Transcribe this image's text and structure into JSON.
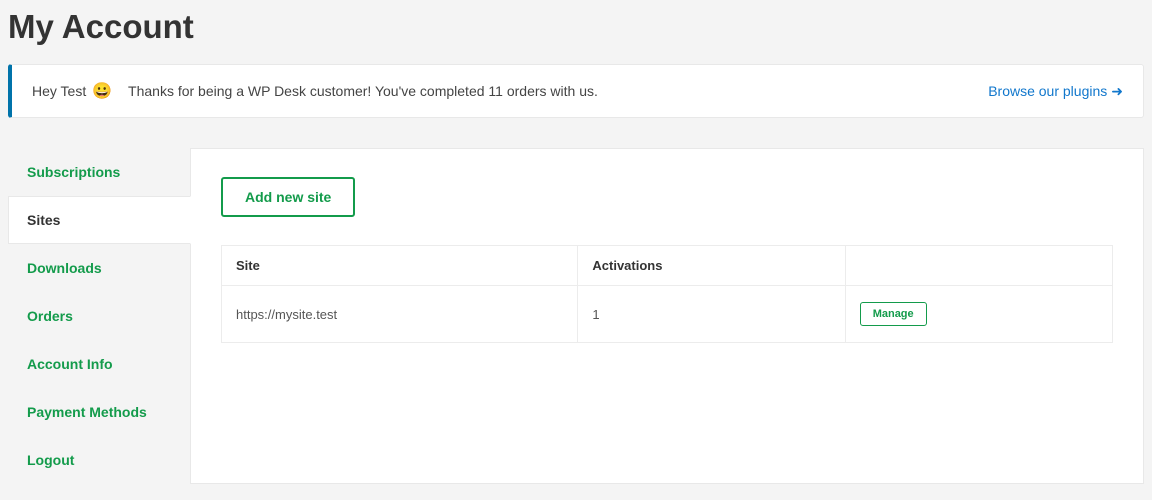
{
  "page_title": "My Account",
  "welcome": {
    "greeting_prefix": "Hey Test",
    "emoji": "😀",
    "greeting_rest": "Thanks for being a WP Desk customer! You've completed 11 orders with us.",
    "browse_label": "Browse our plugins",
    "browse_arrow": "➜"
  },
  "sidebar": {
    "items": [
      {
        "label": "Subscriptions",
        "active": false
      },
      {
        "label": "Sites",
        "active": true
      },
      {
        "label": "Downloads",
        "active": false
      },
      {
        "label": "Orders",
        "active": false
      },
      {
        "label": "Account Info",
        "active": false
      },
      {
        "label": "Payment Methods",
        "active": false
      },
      {
        "label": "Logout",
        "active": false
      }
    ]
  },
  "sites_panel": {
    "add_button": "Add new site",
    "table": {
      "headers": {
        "site": "Site",
        "activations": "Activations",
        "actions": ""
      },
      "rows": [
        {
          "site": "https://mysite.test",
          "activations": "1",
          "manage_label": "Manage"
        }
      ]
    }
  }
}
